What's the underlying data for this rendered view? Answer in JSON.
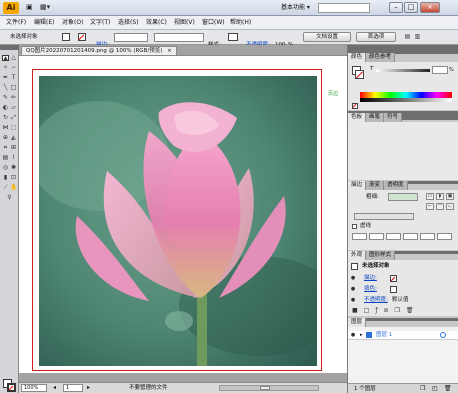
{
  "app": {
    "logo": "Ai",
    "workspace": "基本功能",
    "window_min": "–",
    "window_max": "□",
    "window_close": "×"
  },
  "menu": [
    "文件(F)",
    "编辑(E)",
    "对象(O)",
    "文字(T)",
    "选择(S)",
    "效果(C)",
    "视图(V)",
    "窗口(W)",
    "帮助(H)"
  ],
  "control": {
    "selection": "未选择对象",
    "stroke_label": "描边:",
    "style_label": "样式:",
    "opacity_label": "不透明度:",
    "opacity_value": "100",
    "opacity_unit": "%",
    "doc_setup": "文档设置",
    "preferences": "首选项"
  },
  "document": {
    "tab_title": "QQ图片20220701201409.png @ 100% (RGB/预览)",
    "tab_close": "×",
    "side_note": "页边",
    "zoom": "100%",
    "page": "1",
    "status": "不要管理的文件"
  },
  "panels": {
    "color": {
      "tabs": [
        "颜色",
        "颜色参考"
      ],
      "slider_label": "T",
      "pct_unit": "%"
    },
    "swatches": {
      "tabs": [
        "色板",
        "画笔",
        "符号"
      ]
    },
    "stroke": {
      "tabs": [
        "描边",
        "渐变",
        "透明度"
      ],
      "weight_label": "粗细:",
      "dashed_label": "虚线"
    },
    "appearance": {
      "tabs": [
        "外观",
        "图形样式"
      ],
      "title": "未选择对象",
      "stroke_label": "描边:",
      "fill_label": "填色:",
      "opacity_label": "不透明度:",
      "opacity_value": "默认值"
    },
    "layers": {
      "tabs": [
        "图层"
      ],
      "layer_name": "图层 1",
      "footer": "1 个图层"
    }
  },
  "colors": {
    "accent": "#f6a800",
    "artboard_border": "#d01c1c",
    "selection_blue": "#2c6fd8"
  }
}
